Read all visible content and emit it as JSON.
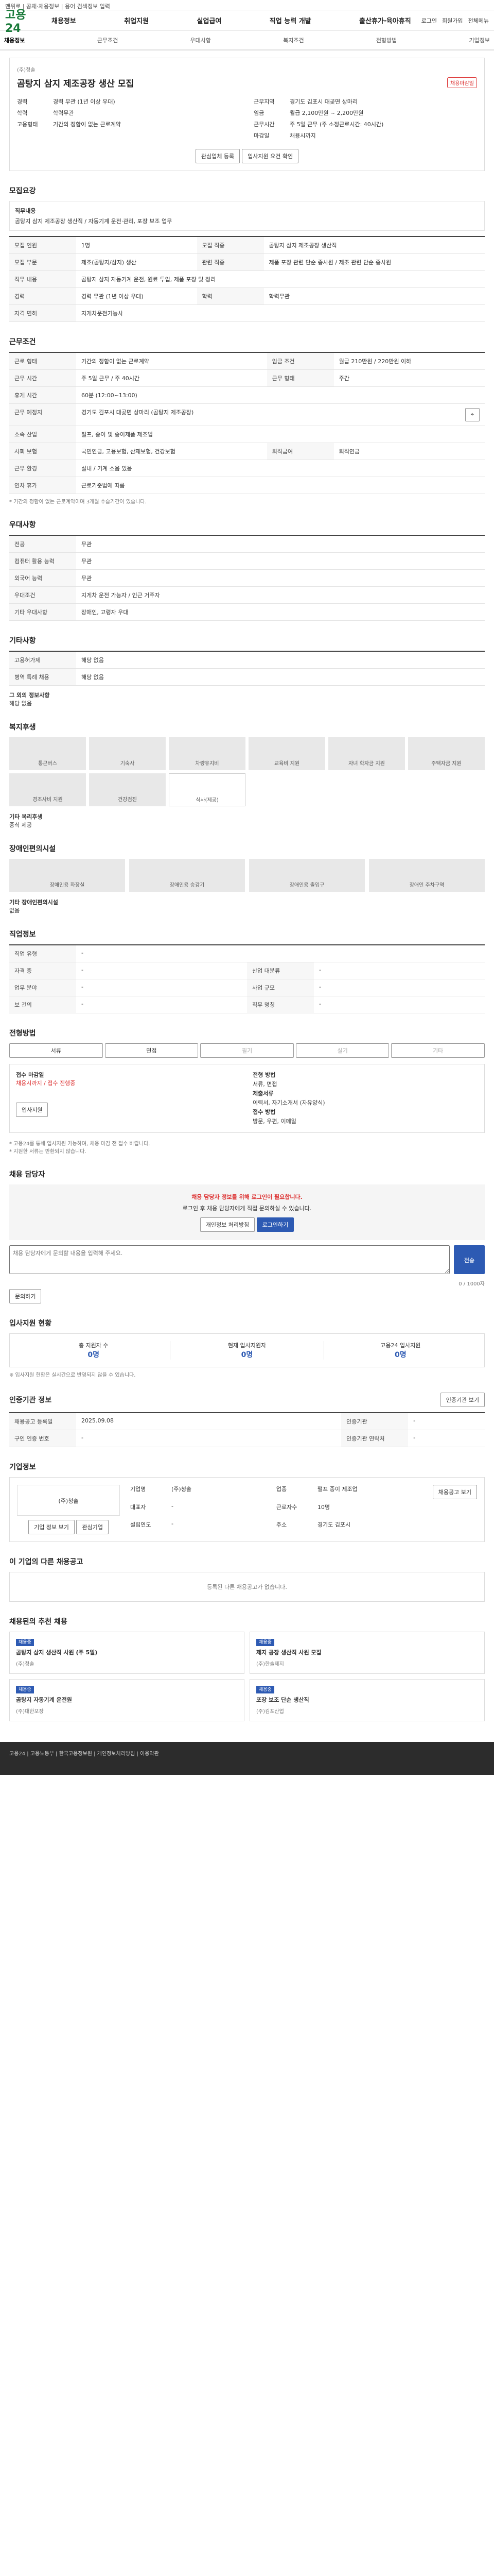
{
  "topbar": "맨위로 | 공채·채용정보 | 용어 검색정보 입력",
  "header": {
    "logo": "고용24",
    "gnb": [
      "채용정보",
      "취업지원",
      "실업급여",
      "직업 능력 개발",
      "출산휴가·육아휴직"
    ],
    "gnbr": [
      "로그인",
      "회원가입",
      "전체메뉴"
    ]
  },
  "lnb": [
    "채용정보",
    "근무조건",
    "우대사항",
    "복지조건",
    "전형방법",
    "기업정보"
  ],
  "job": {
    "company": "(주)청솔",
    "title": "곰탕지 삼지 제조공장 생산 모집",
    "badge": "채용마감일",
    "labels": {
      "career": "경력",
      "edu": "학력",
      "region": "근무지역",
      "wage": "임금",
      "type": "고용형태",
      "hours": "근무시간"
    },
    "career": "경력 무관 (1년 이상 우대)",
    "edu": "학력무관",
    "region": "경기도 김포시 대곶면 상마리",
    "wage": "월급 2,100만원 ~ 2,200만원",
    "type": "기간의 정함이 없는 근로계약",
    "hours": "주 5일 근무 (주 소정근로시간: 40시간)",
    "close_label": "마감일",
    "close": "채용시까지",
    "btn_scrap": "관심업체 등록",
    "btn_apply": "입사지원 요건 확인"
  },
  "s1": {
    "h": "모집요강",
    "box_h": "직무내용",
    "box_t": "곰탕지 삼지 제조공장 생산직 / 자동기계 운전·관리, 포장 보조 업무",
    "rows": [
      [
        "모집 인원",
        "1명",
        "모집 직종",
        "곰탕지 삼지 제조공장 생산직"
      ],
      [
        "모집 부문",
        "제조(곰탕지/삼지) 생산",
        "관련 직종",
        "제품 포장 관련 단순 종사원 / 제조 관련 단순 종사원"
      ],
      [
        "직무 내용",
        "곰탕지 삼지 자동기계 운전, 원료 투입, 제품 포장 및 정리",
        "",
        ""
      ],
      [
        "경력",
        "경력 무관 (1년 이상 우대)",
        "학력",
        "학력무관"
      ],
      [
        "자격 면허",
        "지게차운전기능사",
        "",
        ""
      ]
    ]
  },
  "s2": {
    "h": "근무조건",
    "rows": [
      [
        "근로 형태",
        "기간의 정함이 없는 근로계약",
        "임금 조건",
        "월급 210만원 / 220만원 이하"
      ],
      [
        "근무 시간",
        "주 5일 근무 / 주 40시간",
        "근무 형태",
        "주간"
      ],
      [
        "휴게 시간",
        "60분 (12:00~13:00)",
        "",
        ""
      ],
      [
        "근무 예정지",
        "경기도 김포시 대곶면 상마리 (곰탕지 제조공장)",
        "",
        ""
      ],
      [
        "소속 산업",
        "펄프, 종이 및 종이제품 제조업",
        "",
        ""
      ],
      [
        "사회 보험",
        "국민연금, 고용보험, 산재보험, 건강보험",
        "퇴직급여",
        "퇴직연금"
      ],
      [
        "근무 환경",
        "실내 / 기계 소음 있음",
        "",
        ""
      ],
      [
        "연차 휴가",
        "근로기준법에 따름",
        "",
        ""
      ]
    ],
    "note": "* 기간의 정함이 없는 근로계약이며 3개월 수습기간이 있습니다."
  },
  "s3": {
    "h": "우대사항",
    "rows": [
      [
        "전공",
        "무관"
      ],
      [
        "컴퓨터 활용 능력",
        "무관"
      ],
      [
        "외국어 능력",
        "무관"
      ],
      [
        "우대조건",
        "지게차 운전 가능자 / 인근 거주자"
      ],
      [
        "기타 우대사항",
        "장애인, 고령자 우대"
      ]
    ]
  },
  "s4": {
    "h": "기타사항",
    "rows": [
      [
        "고용허가제",
        "해당 없음"
      ],
      [
        "병역 특례 채용",
        "해당 없음"
      ]
    ],
    "extra_label": "그 외의 정보사항",
    "extra": "해당 없음"
  },
  "s5": {
    "h": "복지후생",
    "items": [
      "통근버스",
      "기숙사",
      "차량유지비",
      "교육비 지원",
      "자녀 학자금 지원",
      "주택자금 지원",
      "경조사비 지원",
      "건강검진",
      "식사(제공)"
    ],
    "etc_label": "기타 복리후생",
    "etc": "중식 제공"
  },
  "s6": {
    "h": "장애인편의시설",
    "items": [
      "장애인용 화장실",
      "장애인용 승강기",
      "장애인용 출입구",
      "장애인 주차구역"
    ],
    "etc_label": "기타 장애인편의시설",
    "etc": "없음"
  },
  "s7": {
    "h": "직업정보",
    "rows": [
      [
        "직업 유형",
        "-",
        "",
        ""
      ],
      [
        "자격 증",
        "-",
        "산업 대분류",
        "-"
      ],
      [
        "업무 분야",
        "-",
        "사업 규모",
        "-"
      ],
      [
        "보 건의",
        "-",
        "직무 명칭",
        "-"
      ]
    ]
  },
  "s8": {
    "h": "전형방법",
    "tabs": [
      "서류",
      "면접",
      "필기",
      "실기",
      "기타"
    ],
    "box": [
      [
        "접수 마감일",
        "채용시까지 / 접수 진행중"
      ],
      [
        "전형 방법",
        "서류, 면접"
      ],
      [
        "제출서류",
        "이력서, 자기소개서 (자유양식)"
      ],
      [
        "접수 방법",
        "방문, 우편, 이메일"
      ]
    ],
    "btn": "입사지원",
    "notes": [
      "* 고용24를 통해 입사지원 가능하며, 채용 마감 전 접수 바랍니다.",
      "* 지원한 서류는 반환되지 않습니다."
    ]
  },
  "s9": {
    "h": "채용 담당자",
    "alert": "채용 담당자 정보를 위해 로그인이 필요합니다.",
    "alert_sub": "로그인 후 채용 담당자에게 직접 문의하실 수 있습니다.",
    "btn1": "개인정보 처리방침",
    "btn2": "로그인하기",
    "ph": "채용 담당자에게 문의할 내용을 입력해 주세요.",
    "count": "0 / 1000자",
    "send": "전송",
    "btn3": "문의하기"
  },
  "s10": {
    "h": "입사지원 현황",
    "stats": [
      [
        "총 지원자 수",
        "0명"
      ],
      [
        "현재 입사지원자",
        "0명"
      ],
      [
        "고용24 입사지원",
        "0명"
      ]
    ],
    "note": "※ 입사지원 현황은 실시간으로 반영되지 않을 수 있습니다."
  },
  "s11": {
    "h": "인증기관 정보",
    "rows": [
      [
        "채용공고 등록일",
        "2025.09.08",
        "인증기관",
        "-"
      ],
      [
        "구인 인증 번호",
        "-",
        "인증기관 연락처",
        "-"
      ]
    ],
    "btn": "인증기관 보기"
  },
  "s12": {
    "h": "기업정보",
    "company": "(주)청솔",
    "info": [
      [
        "기업명",
        "(주)청솔"
      ],
      [
        "업종",
        "펄프 종이 제조업"
      ],
      [
        "대표자",
        "-"
      ],
      [
        "근로자수",
        "10명"
      ],
      [
        "설립연도",
        "-"
      ],
      [
        "주소",
        "경기도 김포시"
      ]
    ],
    "btns": [
      "기업 정보 보기",
      "관심기업"
    ],
    "btn": "채용공고 보기"
  },
  "s13": {
    "h": "이 기업의 다른 채용공고",
    "empty": "등록된 다른 채용공고가 없습니다."
  },
  "s14": {
    "h": "채용된의 추천 채용",
    "cards": [
      {
        "tag": "채용중",
        "title": "곰탕지 삼지 생산직 사원 (주 5일)",
        "co": "(주)청솔"
      },
      {
        "tag": "채용중",
        "title": "제지 공장 생산직 사원 모집",
        "co": "(주)한솔제지"
      },
      {
        "tag": "채용중",
        "title": "곰탕지 자동기계 운전원",
        "co": "(주)대한포장"
      },
      {
        "tag": "채용중",
        "title": "포장 보조 단순 생산직",
        "co": "(주)김포산업"
      }
    ]
  },
  "footer": {
    "text": "고용24 | 고용노동부 | 한국고용정보원 | 개인정보처리방침 | 이용약관"
  }
}
